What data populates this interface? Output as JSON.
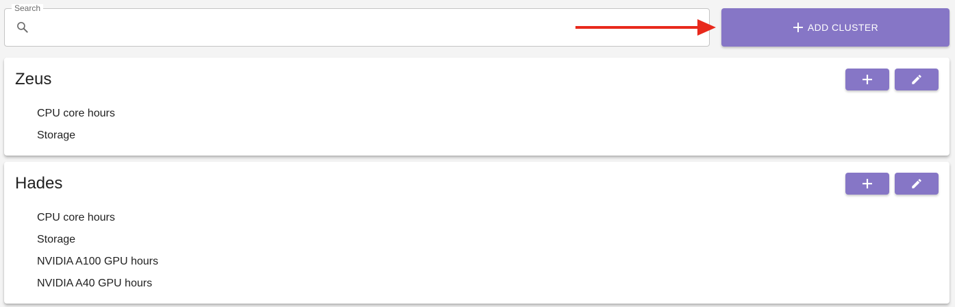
{
  "search": {
    "label": "Search",
    "placeholder": "",
    "value": ""
  },
  "toolbar": {
    "add_cluster_label": "ADD CLUSTER"
  },
  "colors": {
    "accent": "#8676c6",
    "arrow": "#e8291c"
  },
  "icons": {
    "search": "search-icon",
    "plus": "plus-icon",
    "edit": "pencil-icon"
  },
  "clusters": [
    {
      "name": "Zeus",
      "resources": [
        "CPU core hours",
        "Storage"
      ]
    },
    {
      "name": "Hades",
      "resources": [
        "CPU core hours",
        "Storage",
        "NVIDIA A100 GPU hours",
        "NVIDIA A40 GPU hours"
      ]
    }
  ]
}
